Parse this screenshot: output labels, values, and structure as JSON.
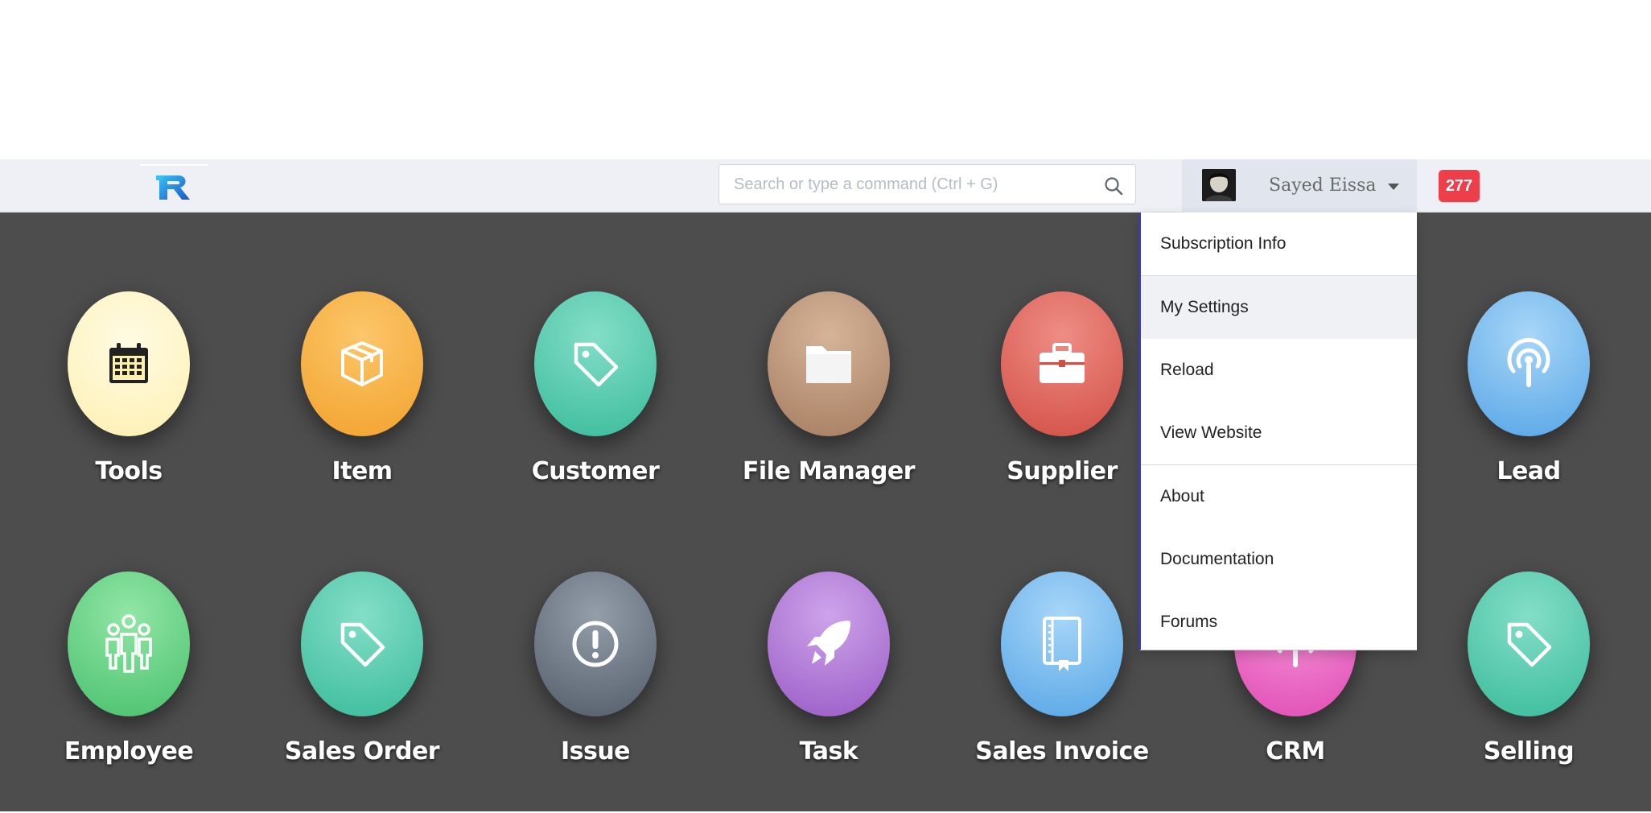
{
  "navbar": {
    "logo_alt": "R",
    "search": {
      "placeholder": "Search or type a command (Ctrl + G)",
      "value": ""
    },
    "user": {
      "name": "Sayed Eissa"
    },
    "notification_count": "277"
  },
  "dropdown": {
    "items": [
      {
        "label": "Subscription Info"
      },
      {
        "label": "My Settings",
        "active": true
      },
      {
        "label": "Reload"
      },
      {
        "label": "View Website"
      },
      {
        "label": "About"
      },
      {
        "label": "Documentation"
      },
      {
        "label": "Forums"
      }
    ]
  },
  "modules": [
    {
      "label": "Tools",
      "color_top": "#fff9d8",
      "color_bottom": "#fcec9c",
      "icon": "calendar-icon"
    },
    {
      "label": "Item",
      "color_top": "#fbc86a",
      "color_bottom": "#f2a52f",
      "icon": "box-icon"
    },
    {
      "label": "Customer",
      "color_top": "#7cdcc6",
      "color_bottom": "#3dbf9e",
      "icon": "tag-icon"
    },
    {
      "label": "File Manager",
      "color_top": "#d4b195",
      "color_bottom": "#ab8266",
      "icon": "folder-icon"
    },
    {
      "label": "Supplier",
      "color_top": "#ec8a82",
      "color_bottom": "#d55046",
      "icon": "briefcase-icon"
    },
    {
      "label": "Lead",
      "color_top": "#a3d2f6",
      "color_bottom": "#5aa8e8",
      "icon": "signal-icon"
    },
    {
      "label": "Employee",
      "color_top": "#8fe4a4",
      "color_bottom": "#4cc470",
      "icon": "people-icon"
    },
    {
      "label": "Sales Order",
      "color_top": "#7cdcc6",
      "color_bottom": "#3dbf9e",
      "icon": "tag-icon"
    },
    {
      "label": "Issue",
      "color_top": "#8d97a4",
      "color_bottom": "#56606c",
      "icon": "alert-icon"
    },
    {
      "label": "Task",
      "color_top": "#c99ee6",
      "color_bottom": "#9d5fc8",
      "icon": "rocket-icon"
    },
    {
      "label": "Sales Invoice",
      "color_top": "#a3d2f6",
      "color_bottom": "#5aa8e8",
      "icon": "book-icon"
    },
    {
      "label": "CRM",
      "color_top": "#f58fd5",
      "color_bottom": "#e452b9",
      "icon": "signal-icon"
    },
    {
      "label": "Selling",
      "color_top": "#7cdcc6",
      "color_bottom": "#3dbf9e",
      "icon": "tag-icon"
    }
  ]
}
